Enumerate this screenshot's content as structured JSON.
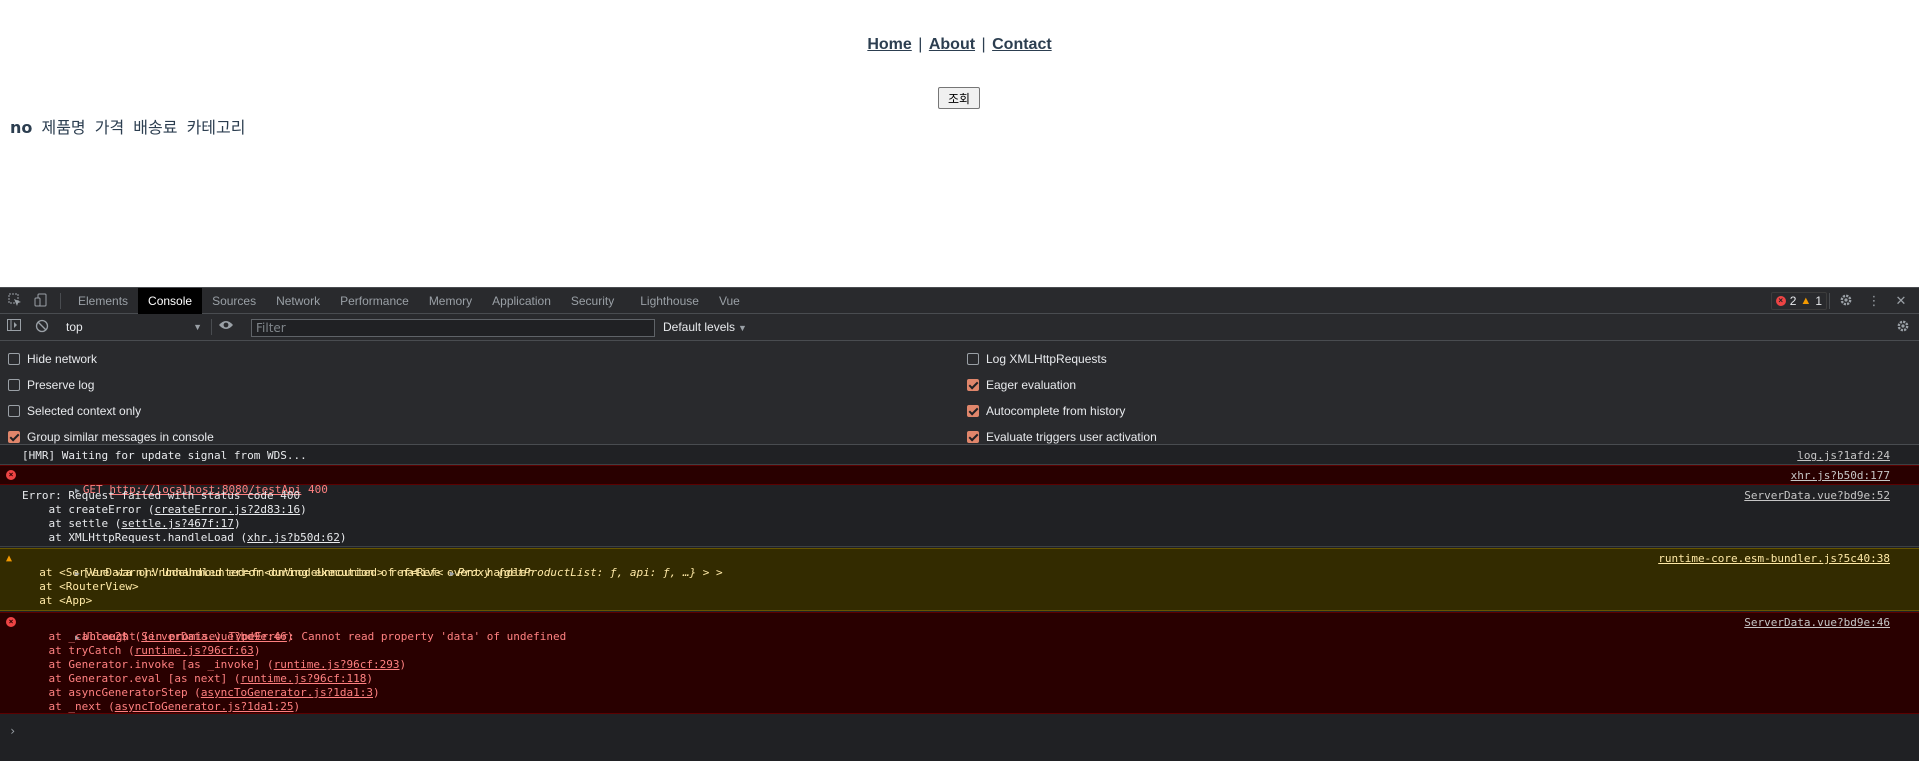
{
  "nav": {
    "home": "Home",
    "about": "About",
    "contact": "Contact",
    "separator": "|"
  },
  "query_button": "조회",
  "table_headers": [
    "no",
    "제품명",
    "가격",
    "배송료",
    "카테고리"
  ],
  "devtools": {
    "tabs": [
      "Elements",
      "Console",
      "Sources",
      "Network",
      "Performance",
      "Memory",
      "Application",
      "Security",
      "Lighthouse",
      "Vue"
    ],
    "active_tab": "Console",
    "error_count": "2",
    "warning_count": "1",
    "context": "top",
    "filter_placeholder": "Filter",
    "levels": "Default levels",
    "settings_left": [
      {
        "label": "Hide network",
        "checked": false
      },
      {
        "label": "Preserve log",
        "checked": false
      },
      {
        "label": "Selected context only",
        "checked": false
      },
      {
        "label": "Group similar messages in console",
        "checked": true
      }
    ],
    "settings_right": [
      {
        "label": "Log XMLHttpRequests",
        "checked": false
      },
      {
        "label": "Eager evaluation",
        "checked": true
      },
      {
        "label": "Autocomplete from history",
        "checked": true
      },
      {
        "label": "Evaluate triggers user activation",
        "checked": true
      }
    ],
    "messages": {
      "hmr": {
        "text": "[HMR] Waiting for update signal from WDS...",
        "source": "log.js?1afd:24"
      },
      "get_error": {
        "method": "GET",
        "url": "http://localhost:8080/testApi",
        "status": "400",
        "source": "xhr.js?b50d:177"
      },
      "request_error": {
        "title": "Error: Request failed with status code 400",
        "source": "ServerData.vue?bd9e:52",
        "stack": [
          {
            "pre": "    at createError (",
            "link": "createError.js?2d83:16",
            "post": ")"
          },
          {
            "pre": "    at settle (",
            "link": "settle.js?467f:17",
            "post": ")"
          },
          {
            "pre": "    at XMLHttpRequest.handleLoad (",
            "link": "xhr.js?b50d:62",
            "post": ")"
          }
        ]
      },
      "vue_warn": {
        "title": "[Vue warn]: Unhandled error during execution of native event handler",
        "source": "runtime-core.esm-bundler.js?5c40:38",
        "line1_pre": "  at <ServerData onVnodeUnmounted=fn<onVnodeUnmounted> ref=Ref< ",
        "line1_proxy": "Proxy ",
        "line1_obj": "{getProductList: ƒ, api: ƒ, …}",
        "line1_post": " > >",
        "line2": "  at <RouterView>",
        "line3": "  at <App>"
      },
      "uncaught": {
        "title": "Uncaught (in promise) TypeError: Cannot read property 'data' of undefined",
        "source": "ServerData.vue?bd9e:46",
        "stack": [
          {
            "pre": "    at _callee2$ (",
            "link": "ServerData.vue?bd9e:46",
            "post": ")"
          },
          {
            "pre": "    at tryCatch (",
            "link": "runtime.js?96cf:63",
            "post": ")"
          },
          {
            "pre": "    at Generator.invoke [as _invoke] (",
            "link": "runtime.js?96cf:293",
            "post": ")"
          },
          {
            "pre": "    at Generator.eval [as next] (",
            "link": "runtime.js?96cf:118",
            "post": ")"
          },
          {
            "pre": "    at asyncGeneratorStep (",
            "link": "asyncToGenerator.js?1da1:3",
            "post": ")"
          },
          {
            "pre": "    at _next (",
            "link": "asyncToGenerator.js?1da1:25",
            "post": ")"
          }
        ]
      }
    },
    "prompt": "›"
  }
}
